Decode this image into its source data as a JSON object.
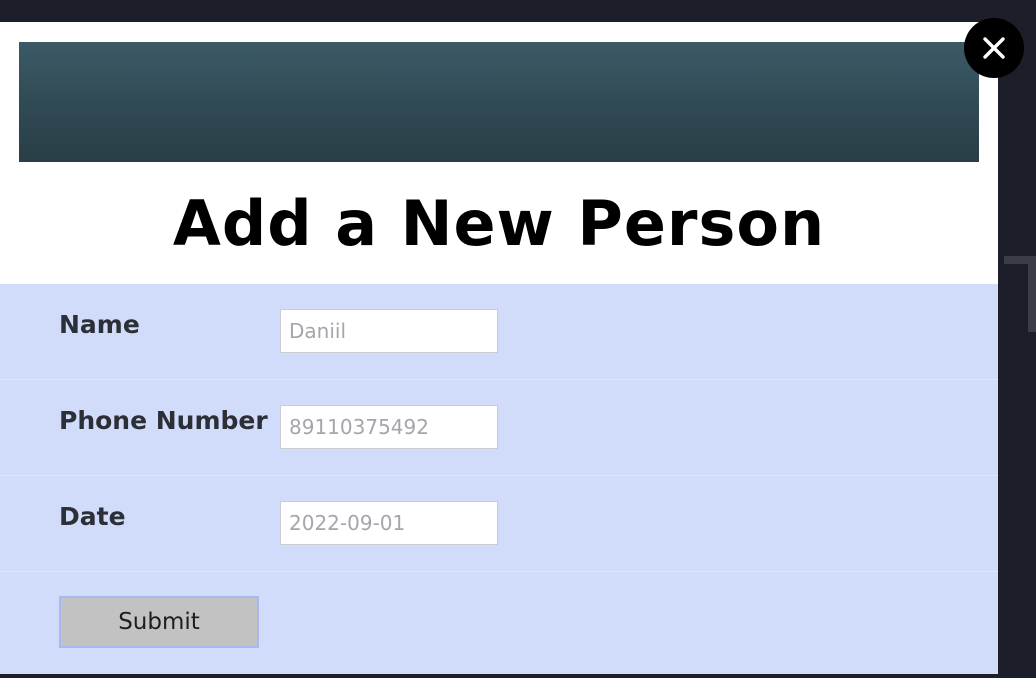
{
  "modal": {
    "title": "Add a New Person",
    "close_icon": "close-icon"
  },
  "form": {
    "fields": [
      {
        "label": "Name",
        "placeholder": "Daniil"
      },
      {
        "label": "Phone Number",
        "placeholder": "89110375492"
      },
      {
        "label": "Date",
        "placeholder": "2022-09-01"
      }
    ],
    "submit_label": "Submit"
  },
  "colors": {
    "backdrop": "#1c1e29",
    "banner": "#2f4852",
    "form_background": "#d0dcfa",
    "submit_background": "#c2c2c2",
    "submit_border": "#a9b8f3"
  }
}
